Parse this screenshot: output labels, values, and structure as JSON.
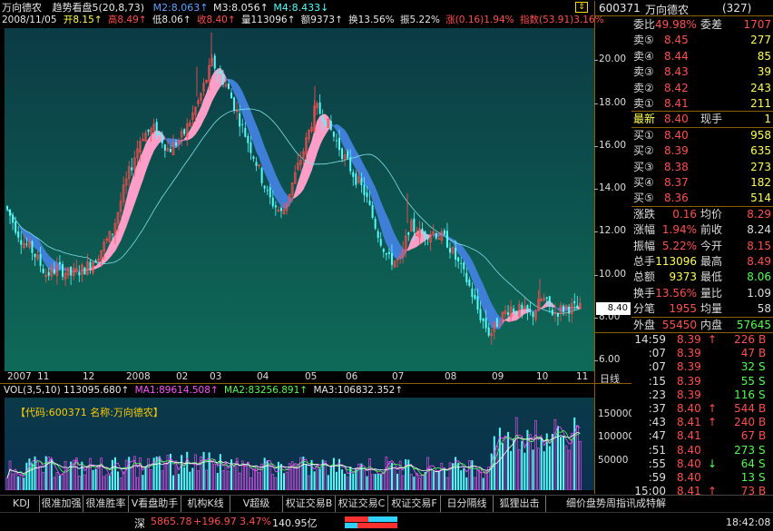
{
  "header": {
    "stock_name": "万向德农",
    "indicator": "趋势看盘5(20,8,73)",
    "m2": "M2:8.063↑",
    "m3": "M3:8.056↑",
    "m4": "M4:8.433↓"
  },
  "infobar": {
    "date": "2008/11/05",
    "open": "开8.15↑",
    "high": "高8.49↑",
    "low": "低8.06↑",
    "close": "收8.40↑",
    "vol": "量113096↑",
    "amount": "额9373↑",
    "turnover": "换13.56%",
    "amplitude": "振5.22%",
    "change": "涨(0.16)1.94%",
    "index": "指数(53.91)3.16%"
  },
  "price_axis": [
    "20.00",
    "18.00",
    "16.00",
    "14.00",
    "12.00",
    "10.00",
    "8.00",
    "6.00"
  ],
  "current_price_label": "8.40",
  "time_axis": [
    "2007",
    "11",
    "12",
    "2008",
    "02",
    "03",
    "04",
    "05",
    "06",
    "07",
    "08",
    "09",
    "10",
    "11"
  ],
  "period_label": "日线",
  "volume_header": {
    "vol": "VOL(3,5,10) 113095.680↑",
    "ma1": "MA1:89614.508↑",
    "ma2": "MA2:83256.891↑",
    "ma3": "MA3:106832.352↑"
  },
  "volume_axis": [
    "150000",
    "100000",
    "50000"
  ],
  "info_text": "【代码:600371 名称:万向德农】",
  "side": {
    "code": "600371",
    "name": "万向德农",
    "count": "(327)",
    "weibi_label": "委比",
    "weibi_value": "49.98%",
    "weicha_label": "委差",
    "weicha_value": "1707",
    "asks": [
      {
        "label": "卖⑤",
        "price": "8.45",
        "vol": "277"
      },
      {
        "label": "卖④",
        "price": "8.44",
        "vol": "85"
      },
      {
        "label": "卖③",
        "price": "8.43",
        "vol": "39"
      },
      {
        "label": "卖②",
        "price": "8.42",
        "vol": "243"
      },
      {
        "label": "卖①",
        "price": "8.41",
        "vol": "211"
      }
    ],
    "latest_label": "最新",
    "latest_value": "8.40",
    "xianshou_label": "现手",
    "xianshou_value": "1",
    "bids": [
      {
        "label": "买①",
        "price": "8.40",
        "vol": "958"
      },
      {
        "label": "买②",
        "price": "8.39",
        "vol": "635"
      },
      {
        "label": "买③",
        "price": "8.38",
        "vol": "273"
      },
      {
        "label": "买④",
        "price": "8.37",
        "vol": "182"
      },
      {
        "label": "买⑤",
        "price": "8.36",
        "vol": "514"
      }
    ],
    "stats": [
      {
        "l1": "涨跌",
        "v1": "0.16",
        "l2": "均价",
        "v2": "8.29"
      },
      {
        "l1": "涨幅",
        "v1": "1.94%",
        "l2": "前收",
        "v2": "8.24"
      },
      {
        "l1": "振幅",
        "v1": "5.22%",
        "l2": "今开",
        "v2": "8.15"
      },
      {
        "l1": "总手",
        "v1": "113096",
        "l2": "最高",
        "v2": "8.49"
      },
      {
        "l1": "总额",
        "v1": "9373",
        "l2": "最低",
        "v2": "8.06"
      },
      {
        "l1": "换手",
        "v1": "13.56%",
        "l2": "量比",
        "v2": "1.09"
      },
      {
        "l1": "分笔",
        "v1": "1955",
        "l2": "均量",
        "v2": "58"
      }
    ],
    "outer_label": "外盘",
    "outer_value": "55450",
    "inner_label": "内盘",
    "inner_value": "57645",
    "ticks": [
      {
        "time": "14:59",
        "price": "8.39",
        "arrow": "↑",
        "vol": "226",
        "side": "B"
      },
      {
        "time": ":07",
        "price": "8.39",
        "arrow": "",
        "vol": "47",
        "side": "B"
      },
      {
        "time": ":07",
        "price": "8.39",
        "arrow": "",
        "vol": "32",
        "side": "S"
      },
      {
        "time": ":15",
        "price": "8.39",
        "arrow": "",
        "vol": "55",
        "side": "S"
      },
      {
        "time": ":23",
        "price": "8.39",
        "arrow": "",
        "vol": "116",
        "side": "S"
      },
      {
        "time": ":37",
        "price": "8.40",
        "arrow": "↑",
        "vol": "544",
        "side": "B"
      },
      {
        "time": ":43",
        "price": "8.41",
        "arrow": "↑",
        "vol": "240",
        "side": "B"
      },
      {
        "time": ":47",
        "price": "8.41",
        "arrow": "",
        "vol": "67",
        "side": "B"
      },
      {
        "time": ":51",
        "price": "8.40",
        "arrow": "",
        "vol": "273",
        "side": "S"
      },
      {
        "time": ":55",
        "price": "8.40",
        "arrow": "↓",
        "vol": "64",
        "side": "S"
      },
      {
        "time": ":59",
        "price": "8.40",
        "arrow": "",
        "vol": "13",
        "side": "S"
      },
      {
        "time": "15:00",
        "price": "8.41",
        "arrow": "↑",
        "vol": "73",
        "side": "B"
      },
      {
        "time": ":00",
        "price": "8.40",
        "arrow": "↓",
        "vol": "1",
        "side": "S"
      }
    ]
  },
  "tabs": [
    "KDJ",
    "很准加强",
    "很准胜率",
    "V看盘助手",
    "机构K线(修",
    "V超级MACD",
    "权证交易B",
    "权证交易C",
    "权证交易F",
    "日分隔线",
    "狐狸出击",
    "细价盘势周指讯成特解"
  ],
  "status": {
    "market": "深",
    "index_value": "5865.78",
    "index_change": "+196.97",
    "index_pct": "3.47%",
    "turnover": "140.95亿",
    "time": "18:42:08"
  },
  "colors": {
    "up": "#ff5050",
    "down": "#54fcfc",
    "ribbon_up": "#ff9ec8",
    "ribbon_down": "#3f7fd8",
    "panel_bg_top": "#0b3b45",
    "panel_bg_bottom": "#0d6a5a"
  }
}
